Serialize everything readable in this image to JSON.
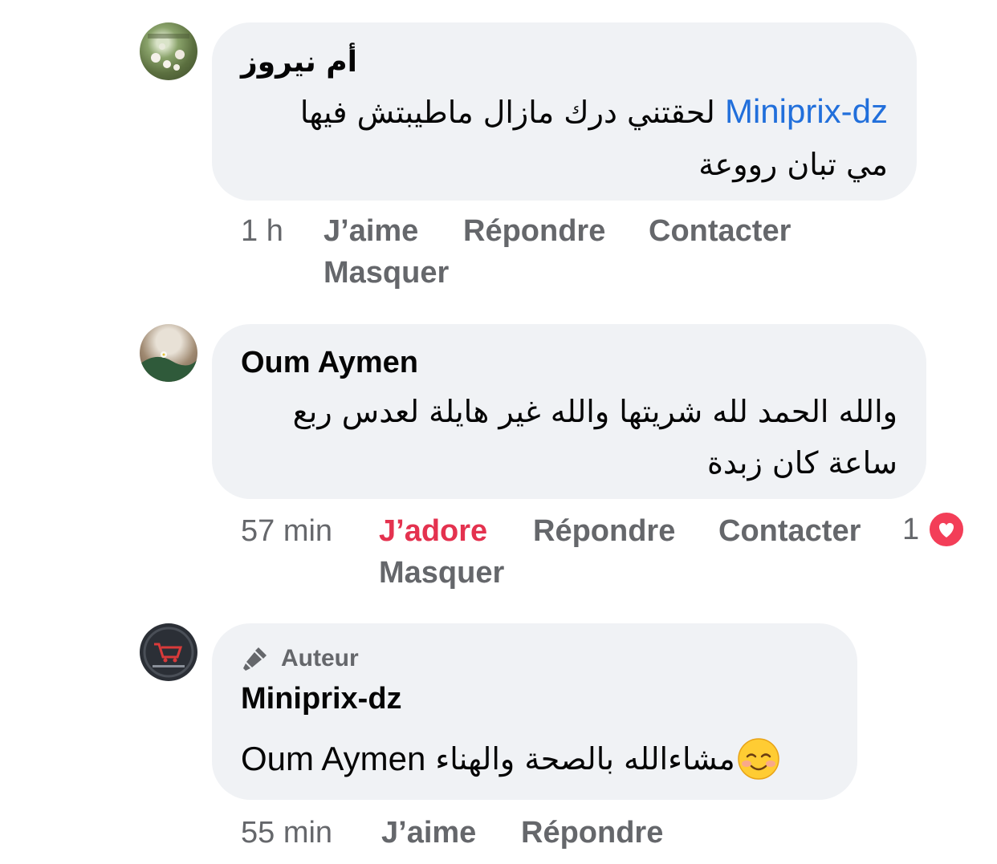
{
  "comments": [
    {
      "author": "أم نيروز",
      "mention": "Miniprix-dz",
      "text_line1_rest": " لحقتني درك مازال ماطيبتش فيها",
      "text_line2": "مي تبان رووعة",
      "time": "1 h",
      "actions": {
        "like": "J’aime",
        "reply": "Répondre",
        "contact": "Contacter",
        "hide": "Masquer"
      }
    },
    {
      "author": "Oum Aymen",
      "text_line1": "والله الحمد لله شريتها والله غير هايلة لعدس ربع",
      "text_line2": "ساعة كان زبدة",
      "time": "57 min",
      "actions": {
        "like": "J’adore",
        "reply": "Répondre",
        "contact": "Contacter",
        "hide": "Masquer"
      },
      "reactions": {
        "count": "1",
        "icon": "heart-icon",
        "color": "#f33e58"
      }
    },
    {
      "badge": "Auteur",
      "author": "Miniprix-dz",
      "mention": "Oum Aymen",
      "text_rest": "مشاءالله بالصحة والهناء",
      "emoji": "☺️",
      "time": "55 min",
      "actions": {
        "like": "J’aime",
        "reply": "Répondre"
      }
    }
  ],
  "colors": {
    "bubble": "#f0f2f5",
    "meta": "#65676b",
    "link": "#216fdb",
    "love": "#e4324f"
  }
}
